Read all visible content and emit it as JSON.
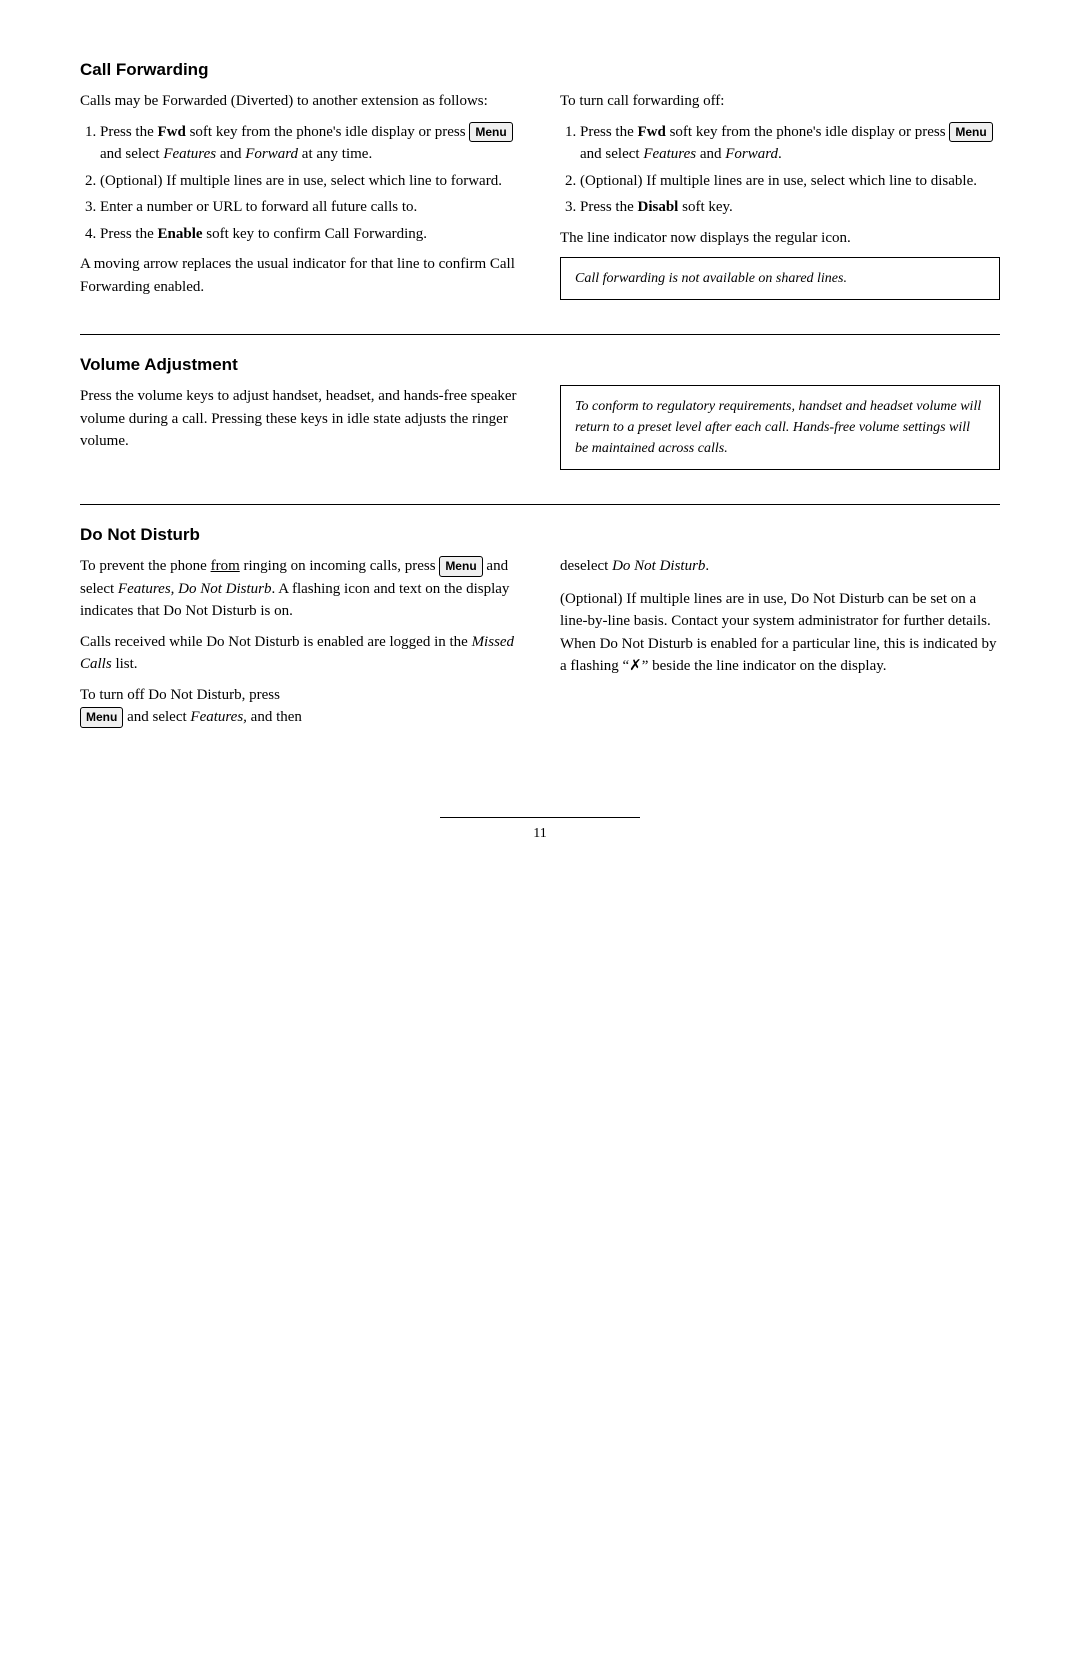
{
  "sections": {
    "call_forwarding": {
      "heading": "Call Forwarding",
      "left_col": {
        "intro": "Calls may be Forwarded (Diverted) to another extension as follows:",
        "steps": [
          "Press the <b>Fwd</b> soft key from the phone's idle display or press <menu> and select <i>Features</i> and <i>Forward</i> at any time.",
          "(Optional) If multiple lines are in use, select which line to forward.",
          "Enter a number or URL to forward all future calls to.",
          "Press the <b>Enable</b> soft key to confirm Call Forwarding."
        ],
        "closing": "A moving arrow replaces the usual indicator for that line to confirm Call Forwarding enabled."
      },
      "right_col": {
        "turn_off_label": "To turn call forwarding off:",
        "turn_off_steps": [
          "Press the <b>Fwd</b> soft key from the phone's idle display or press <menu> and select <i>Features</i> and <i>Forward</i>.",
          "(Optional) If multiple lines are in use, select which line to disable.",
          "Press the <b>Disabl</b> soft key."
        ],
        "closing": "The line indicator now displays the regular icon.",
        "note": "Call forwarding is not available on shared lines."
      }
    },
    "volume_adjustment": {
      "heading": "Volume Adjustment",
      "left_col": {
        "text": "Press the volume keys to adjust handset, headset, and hands-free speaker volume during a call.  Pressing these keys in idle state adjusts the ringer volume."
      },
      "right_col": {
        "note": "To conform to regulatory requirements, handset and headset volume will return to a preset level after each call.  Hands-free volume settings will be maintained across calls."
      }
    },
    "do_not_disturb": {
      "heading": "Do Not Disturb",
      "left_col": {
        "para1_prefix": "To prevent the phone from ringing on incoming calls, press ",
        "para1_suffix": " and select Features, Do Not Disturb.  A flashing icon and text on the display indicates that Do Not Disturb is on.",
        "para2": "Calls received while Do Not Disturb is enabled are logged in the Missed Calls list.",
        "para3_prefix": "To turn off Do Not Disturb, press ",
        "para3_suffix": " and select Features, and then"
      },
      "right_col": {
        "para1": "deselect Do Not Disturb.",
        "para2": "(Optional) If multiple lines are in use, Do Not Disturb can be set on a line-by-line basis.  Contact your system administrator for further details.  When Do Not Disturb is enabled for a particular line, this is indicated by a flashing “✗” beside the line indicator on the display."
      }
    }
  },
  "menu_label": "Menu",
  "page_number": "11"
}
